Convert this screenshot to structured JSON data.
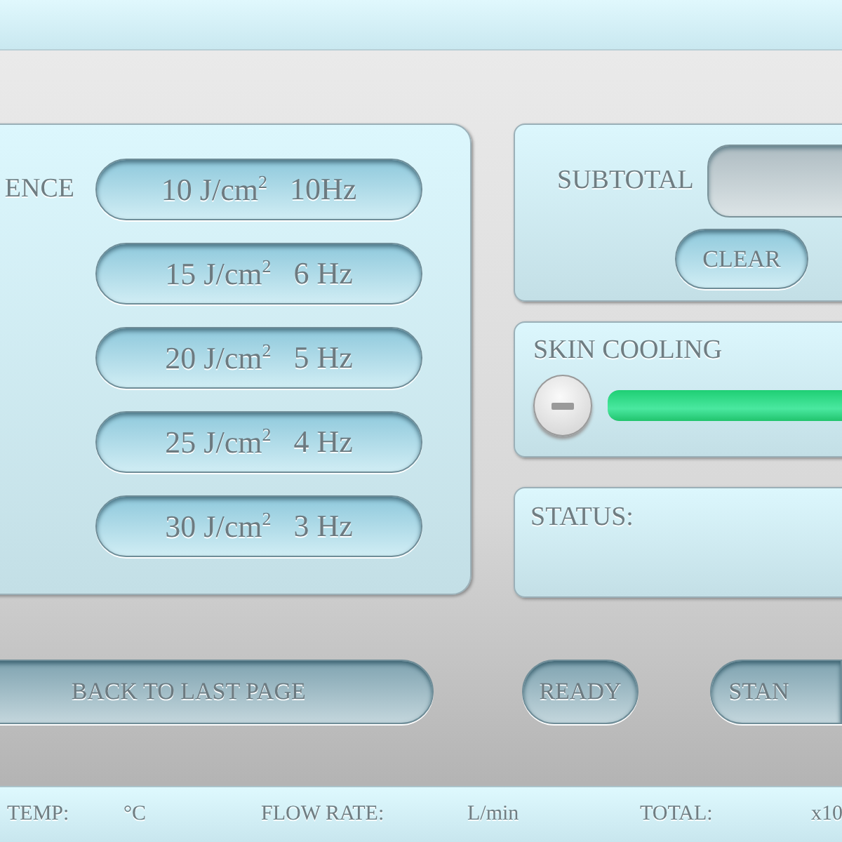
{
  "fluence_panel": {
    "label": "ENCE",
    "options": [
      {
        "fluence": "10 J/cm$^{2}$",
        "frequency": "10Hz"
      },
      {
        "fluence": "15 J/cm$^{2}$",
        "frequency": "6 Hz"
      },
      {
        "fluence": "20 J/cm$^{2}$",
        "frequency": "5 Hz"
      },
      {
        "fluence": "25 J/cm$^{2}$",
        "frequency": "4 Hz"
      },
      {
        "fluence": "30 J/cm$^{2}$",
        "frequency": "3 Hz"
      }
    ]
  },
  "subtotal_panel": {
    "label": "SUBTOTAL",
    "clear_button": "CLEAR"
  },
  "skin_cooling": {
    "title": "SKIN COOLING",
    "level": 1
  },
  "status_panel": {
    "label": "STATUS:"
  },
  "buttons": [
    "BACK TO LAST PAGE",
    "READY",
    "STAN"
  ],
  "status_bar": [
    {
      "text": "TEMP:"
    },
    {
      "text": "°C"
    },
    {
      "text": "FLOW RATE:"
    },
    {
      "text": "L/min"
    },
    {
      "text": "TOTAL:"
    },
    {
      "text": "x10"
    }
  ]
}
